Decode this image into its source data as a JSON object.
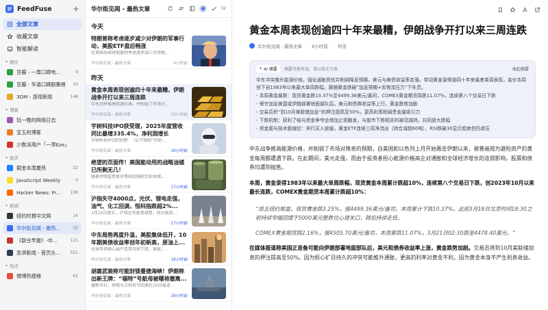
{
  "app": {
    "name": "FeedFuse",
    "add": "+"
  },
  "nav": [
    {
      "label": "全部文章",
      "icon": "articles-icon",
      "active": true
    },
    {
      "label": "收藏文章",
      "icon": "star-icon",
      "active": false
    },
    {
      "label": "智能解读",
      "icon": "ai-icon",
      "active": false
    }
  ],
  "groups": [
    {
      "label": "娱乐",
      "feeds": [
        {
          "name": "豆瓣 - 一周口碑电...",
          "count": "9",
          "color": "#2e9e44"
        },
        {
          "name": "豆瓣 - 华语口碑剧集榜",
          "count": "10",
          "color": "#2e9e44"
        },
        {
          "name": "3DM - 游戏新闻",
          "count": "148",
          "color": "#e6a823"
        }
      ]
    },
    {
      "label": "博客",
      "feeds": [
        {
          "name": "玩一晚的网络日志",
          "count": "",
          "color": "#9b59b6"
        },
        {
          "name": "宝玉的博客",
          "count": "",
          "color": "#e67e22"
        },
        {
          "name": "少数派用户「一萍Eze」",
          "count": "",
          "color": "#d63031"
        }
      ]
    },
    {
      "label": "技术",
      "feeds": [
        {
          "name": "掘金本周最热",
          "count": "22",
          "color": "#1e80ff"
        },
        {
          "name": "JavaScript Weekly",
          "count": "0",
          "color": "#f7df1e"
        },
        {
          "name": "Hacker News: Fr...",
          "count": "108",
          "color": "#ff6600"
        }
      ]
    },
    {
      "label": "新闻",
      "feeds": [
        {
          "name": "纽约时报中文网",
          "count": "14",
          "color": "#333333"
        },
        {
          "name": "华尔街见闻 - 最热...",
          "count": "32",
          "color": "#3a6df0",
          "active": true
        },
        {
          "name": "《联合早报》-中...",
          "count": "121",
          "color": "#c0392b"
        },
        {
          "name": "澎湃新闻 - 首页头...",
          "count": "551",
          "color": "#2c3e50"
        }
      ]
    },
    {
      "label": "热点",
      "feeds": [
        {
          "name": "微博热搜榜",
          "count": "62",
          "color": "#e74c3c"
        }
      ]
    }
  ],
  "list": {
    "title": "华尔街见闻 - 最热文章",
    "count": "32",
    "today": "今天",
    "yesterday": "昨天",
    "today_articles": [
      {
        "title": "特朗普称考虑逐步减少对伊朗的军事行动，美股ETF盘后畅涨",
        "summary": "在美国总统特朗普称考虑逐步减少对伊朗...",
        "source": "华尔街见闻 - 最热文章",
        "time": "4小时前",
        "thumb": "trump"
      }
    ],
    "yesterday_articles": [
      {
        "title": "黄金本周表现创逾四十年来最糟，伊朗战争开打以来三周连跌",
        "summary": "中东战争推高能源价格，并削弱了市场对...",
        "source": "华尔街见闻 - 最热文章",
        "time": "10小时前",
        "thumb": "gold",
        "active": true
      },
      {
        "title": "宇树科技IPO获受理，2025年度营收同比暴增335.4%，净利润增长204%！",
        "summary": "宇树科技IPO获受理！（以下指称“宇树...",
        "source": "华尔街见闻 - 最热文章",
        "time": "16小时前",
        "thumb": "robot",
        "blue": true
      },
      {
        "title": "绝望的页面传！美国能动用的战略油储已所剩无几！",
        "summary": "随着伊朗敌意美日等国加强配合抑油储...",
        "source": "华尔街见闻 - 最热文章",
        "time": "17小时前",
        "thumb": "oil",
        "blue": true
      },
      {
        "title": "沪指失守4000点，光伏、锂电走强，油气、化工回调，恒科指跌超2%...",
        "summary": "3月20日周五，沪指全天震荡调整，创业板指...",
        "source": "华尔街见闻 - 最热文章",
        "time": "17小时前",
        "thumb": "arrows",
        "blue": true
      },
      {
        "title": "中东局势再度升温，美股集体低开，10年期美债收益率创年初新高，原油上...",
        "summary": "全球市场核心围产走势持续下跌，美股...",
        "source": "华尔街见闻 - 最热文章",
        "time": "18小时前",
        "thumb": "city",
        "blue": true
      },
      {
        "title": "胡塞武装称可能封锁曼德海峡！伊朗称出新王牌：“福特”号航母被曝将撤离...",
        "summary": "据新华社，伊朗军方称其写回源在20日报道...",
        "source": "华尔街见闻 - 最热文章",
        "time": "18小时前",
        "thumb": "ship",
        "blue": true
      }
    ]
  },
  "article": {
    "title": "黄金本周表现创逾四十年来最糟，伊朗战争开打以来三周连跌",
    "source": "华尔街见闻 - 最热文章",
    "time": "8小时前",
    "author": "何浩",
    "ai": {
      "tag": "AI 摘要",
      "hint": "摘要可能有误，请以原文为准",
      "collapse": "收起摘要",
      "intro": "中东冲突推升能源价格，强化通胀担忧并削弱降息预期，美元与美债收益率走强，带动黄金录得逾四十年来最差单周表现，金价本周创下自1983年以来最大单周跌幅，跟随黄金跌破“加息预期+实物流压力”下失灵。",
      "bullets": [
        "- 本周黄金暴跌：现货黄金跌10.37%至4499.36美元/盎司，COMEX黄金期货周跌11.07%，连续第八个交易日下跌",
        "- 保守加息美国或伊朗部署地面部队后，美元和债券收益率上行，黄金跌势加剧",
        "- 交易员积“到10月美联储加息”的押注提高至50%，更高利率削弱贵金属吸引力",
        "- 下跌机制：获利了结与资金争夺会增加止损触发，与股市下跌相关的被动减持，共同放大跌幅",
        "- 资金面与技术面偏空：央行买入放缓，黄金ETF连续三周净流出（持合减超60吨），RSI跌破30显示超卖但仍承压"
      ]
    },
    "paragraphs": [
      {
        "type": "p",
        "text": "中东战争推高能源价格，并削弱了市场对降息的预期，自美国和以色列上月开始轰击伊朗以来，被普遍视为避险资产的黄金每周都遭遇下跌。在此期间，美元走强，而由于投资者担心能源价格高企对通胀和全球经济增长的连锁影响，股票和债券均遭到抛售。"
      },
      {
        "type": "bold",
        "text": "本周，黄金录得1983年以来最大单周跌幅，现货黄金本周累计跌超10%，连续第八个交易日下跌，创2023年10月以来最长连跌，COMEX黄金期货本周累计跌超10%："
      },
      {
        "type": "quote",
        "text": "“周五纽约尾盘，现货黄金跌3.25%，报4499.36美元/盎司，本周累计下跌10.37%。此前3月18日北京时间18:30之前持续窄幅回摆于5000美元整数位心理关口，随后持续走低。"
      },
      {
        "type": "quote",
        "text": "COMEX黄金期货跌2.16%，报4505.70美元/盎司，本周累跌11.07%，3月21日02:30跌至4478.40美元。”"
      },
      {
        "type": "mix",
        "bold": "在媒体报道称美国正准备可能向伊朗部署地面部队后，美元和债券收益率上涨，黄金跌势加剧。",
        "text": "交易员将到10月美联储加息的押注提高至50%。因为担心扩日持久的冲突可能推升通胀，更高的利率对黄金不利，因为黄金本身不产生利息收益。"
      }
    ]
  }
}
